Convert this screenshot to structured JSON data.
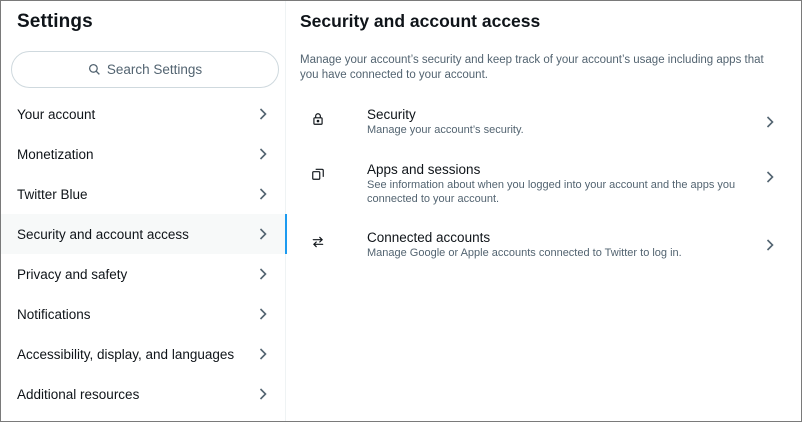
{
  "left": {
    "title": "Settings",
    "search_placeholder": "Search Settings",
    "items": [
      {
        "label": "Your account"
      },
      {
        "label": "Monetization"
      },
      {
        "label": "Twitter Blue"
      },
      {
        "label": "Security and account access",
        "active": true
      },
      {
        "label": "Privacy and safety"
      },
      {
        "label": "Notifications"
      },
      {
        "label": "Accessibility, display, and languages"
      },
      {
        "label": "Additional resources"
      }
    ]
  },
  "right": {
    "title": "Security and account access",
    "description": "Manage your account’s security and keep track of your account’s usage including apps that you have connected to your account.",
    "options": [
      {
        "icon": "lock-icon",
        "title": "Security",
        "subtitle": "Manage your account’s security."
      },
      {
        "icon": "apps-icon",
        "title": "Apps and sessions",
        "subtitle": "See information about when you logged into your account and the apps you connected to your account."
      },
      {
        "icon": "arrows-swap-icon",
        "title": "Connected accounts",
        "subtitle": "Manage Google or Apple accounts connected to Twitter to log in."
      }
    ]
  },
  "colors": {
    "accent": "#1d9bf0",
    "text": "#0f1419",
    "muted": "#536471",
    "active_bg": "#f7f9f9"
  }
}
